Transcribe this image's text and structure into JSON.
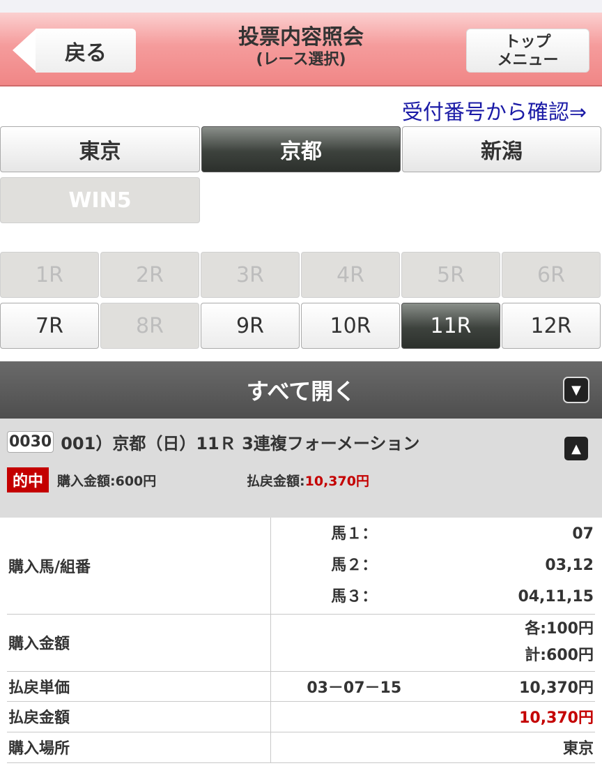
{
  "header": {
    "back_label": "戻る",
    "title_line1": "投票内容照会",
    "title_line2": "(レース選択)",
    "top_line1": "トップ",
    "top_line2": "メニュー"
  },
  "confirm_link": "受付番号から確認⇒",
  "venues": [
    "東京",
    "京都",
    "新潟"
  ],
  "venue_active": "京都",
  "win5_label": "WIN5",
  "races_row1": [
    "1R",
    "2R",
    "3R",
    "4R",
    "5R",
    "6R"
  ],
  "races_row2": [
    "7R",
    "8R",
    "9R",
    "10R",
    "11R",
    "12R"
  ],
  "race_active": "11R",
  "open_all_label": "すべて開く",
  "ticket": {
    "id": "0030",
    "description": "001）京都（日）11Ｒ 3連複フォーメーション",
    "hit_badge": "的中",
    "purchase_label": "購入金額:600円",
    "payout_label": "払戻金額:",
    "payout_value": "10,370円"
  },
  "detail": {
    "combo_label": "購入馬/組番",
    "horse1_label": "馬１：",
    "horse1_value": "07",
    "horse2_label": "馬２：",
    "horse2_value": "03,12",
    "horse3_label": "馬３：",
    "horse3_value": "04,11,15",
    "amount_label": "購入金額",
    "amount_each": "各:100円",
    "amount_total": "計:600円",
    "unit_label": "払戻単価",
    "unit_combo": "03－07－15",
    "unit_value": "10,370円",
    "payout_label": "払戻金額",
    "payout_value": "10,370円",
    "place_label": "購入場所",
    "place_value": "東京"
  },
  "colors": {
    "header_pink": "#f59c9c",
    "active_tab": "#3d423d",
    "hit_red": "#c40000",
    "link_blue": "#1a1aa6"
  }
}
